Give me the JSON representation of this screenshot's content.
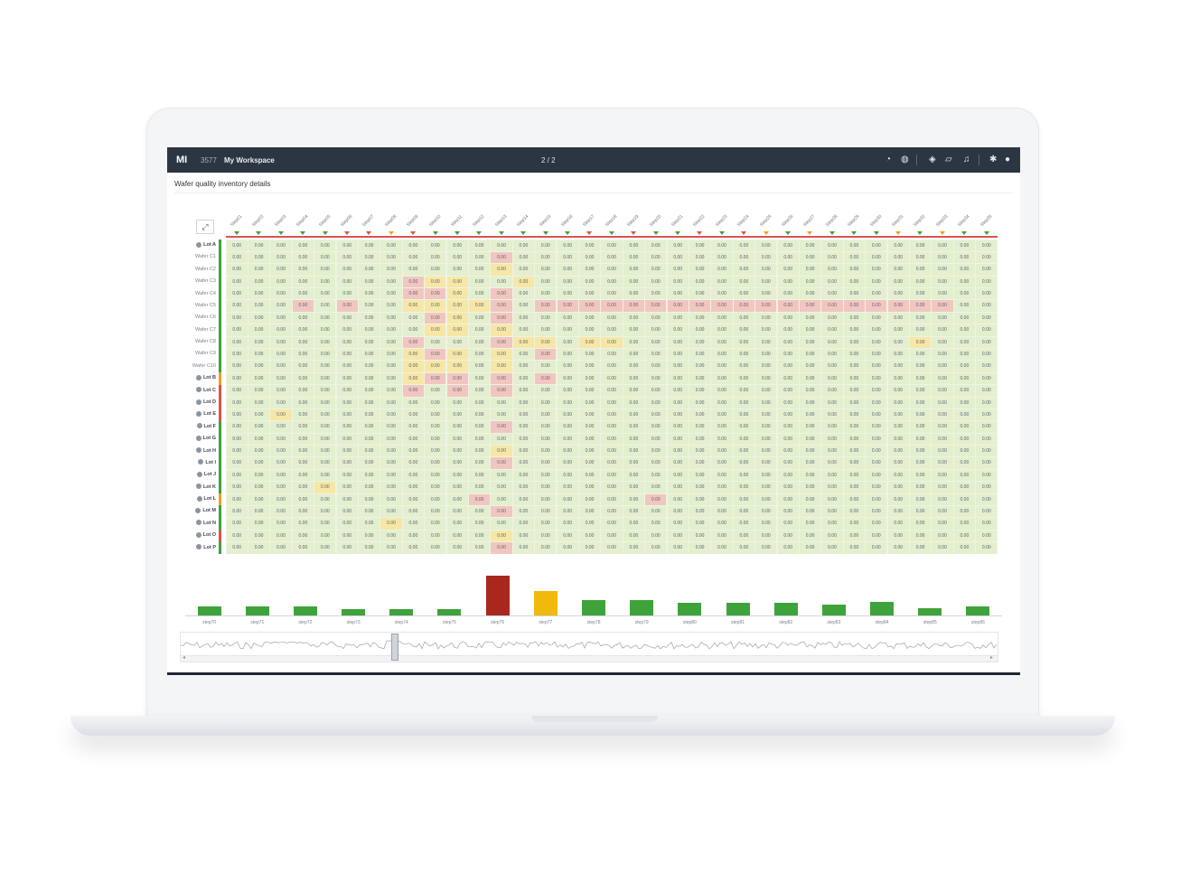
{
  "app": {
    "logo": "MI",
    "workspace_id": "3577",
    "workspace_name": "My Workspace",
    "pager": "2 / 2",
    "icons": [
      "dashboard-icon",
      "globe-icon",
      "cube-icon",
      "map-icon",
      "bell-icon",
      "gear-icon",
      "user-icon"
    ]
  },
  "page": {
    "subtitle": "Wafer quality inventory details",
    "expand_icon": "⤢"
  },
  "matrix": {
    "columns": [
      "Step01",
      "Step02",
      "Step03",
      "Step04",
      "Step05",
      "Step06",
      "Step07",
      "Step08",
      "Step09",
      "Step10",
      "Step11",
      "Step12",
      "Step13",
      "Step14",
      "Step15",
      "Step16",
      "Step17",
      "Step18",
      "Step19",
      "Step20",
      "Step21",
      "Step22",
      "Step23",
      "Step24",
      "Step25",
      "Step26",
      "Step27",
      "Step28",
      "Step29",
      "Step30",
      "Step31",
      "Step32",
      "Step33",
      "Step34",
      "Step35"
    ],
    "column_markers": [
      "green",
      "green",
      "green",
      "green",
      "green",
      "red",
      "red",
      "orange",
      "red",
      "green",
      "green",
      "green",
      "green",
      "green",
      "green",
      "green",
      "red",
      "green",
      "red",
      "green",
      "green",
      "red",
      "green",
      "red",
      "orange",
      "green",
      "orange",
      "green",
      "green",
      "green",
      "orange",
      "green",
      "orange",
      "green",
      "green"
    ],
    "rows": [
      {
        "label": "Lot A",
        "lot": true,
        "status": "green"
      },
      {
        "label": "Wafer C1",
        "lot": false,
        "status": "green"
      },
      {
        "label": "Wafer C2",
        "lot": false,
        "status": "green"
      },
      {
        "label": "Wafer C3",
        "lot": false,
        "status": "green"
      },
      {
        "label": "Wafer C4",
        "lot": false,
        "status": "green"
      },
      {
        "label": "Wafer C5",
        "lot": false,
        "status": "green"
      },
      {
        "label": "Wafer C6",
        "lot": false,
        "status": "green"
      },
      {
        "label": "Wafer C7",
        "lot": false,
        "status": "green"
      },
      {
        "label": "Wafer C8",
        "lot": false,
        "status": "green"
      },
      {
        "label": "Wafer C9",
        "lot": false,
        "status": "green"
      },
      {
        "label": "Wafer C10",
        "lot": false,
        "status": "green"
      },
      {
        "label": "Lot B",
        "lot": true,
        "status": "orange"
      },
      {
        "label": "Lot C",
        "lot": true,
        "status": "red"
      },
      {
        "label": "Lot D",
        "lot": true,
        "status": "red"
      },
      {
        "label": "Lot E",
        "lot": true,
        "status": "red"
      },
      {
        "label": "Lot F",
        "lot": true,
        "status": "green"
      },
      {
        "label": "Lot G",
        "lot": true,
        "status": "green"
      },
      {
        "label": "Lot H",
        "lot": true,
        "status": "green"
      },
      {
        "label": "Lot I",
        "lot": true,
        "status": "green"
      },
      {
        "label": "Lot J",
        "lot": true,
        "status": "green"
      },
      {
        "label": "Lot K",
        "lot": true,
        "status": "green"
      },
      {
        "label": "Lot L",
        "lot": true,
        "status": "orange"
      },
      {
        "label": "Lot M",
        "lot": true,
        "status": "green"
      },
      {
        "label": "Lot N",
        "lot": true,
        "status": "green"
      },
      {
        "label": "Lot O",
        "lot": true,
        "status": "red"
      },
      {
        "label": "Lot P",
        "lot": true,
        "status": "green"
      }
    ],
    "cell_values": [
      "0.00",
      "0.00",
      "0.00",
      "0.00"
    ],
    "highlights": [
      {
        "row": 1,
        "col": 12,
        "color": "red"
      },
      {
        "row": 2,
        "col": 12,
        "color": "yellow"
      },
      {
        "row": 3,
        "col": 8,
        "color": "red"
      },
      {
        "row": 3,
        "col": 9,
        "color": "yellow"
      },
      {
        "row": 3,
        "col": 10,
        "color": "yellow"
      },
      {
        "row": 3,
        "col": 13,
        "color": "yellow"
      },
      {
        "row": 4,
        "col": 8,
        "color": "red"
      },
      {
        "row": 4,
        "col": 9,
        "color": "red"
      },
      {
        "row": 4,
        "col": 10,
        "color": "yellow"
      },
      {
        "row": 4,
        "col": 12,
        "color": "red"
      },
      {
        "row": 5,
        "col": 3,
        "color": "red"
      },
      {
        "row": 5,
        "col": 5,
        "color": "red"
      },
      {
        "row": 5,
        "col": 8,
        "color": "yellow"
      },
      {
        "row": 5,
        "col": 9,
        "color": "yellow"
      },
      {
        "row": 5,
        "col": 10,
        "color": "yellow"
      },
      {
        "row": 5,
        "col": 11,
        "color": "yellow"
      },
      {
        "row": 5,
        "col": 12,
        "color": "red"
      },
      {
        "row": 5,
        "col": 14,
        "color": "red"
      },
      {
        "row": 5,
        "col": 15,
        "color": "red"
      },
      {
        "row": 5,
        "col": 16,
        "color": "red"
      },
      {
        "row": 5,
        "col": 17,
        "color": "red"
      },
      {
        "row": 5,
        "col": 18,
        "color": "red"
      },
      {
        "row": 5,
        "col": 19,
        "color": "red"
      },
      {
        "row": 5,
        "col": 20,
        "color": "red"
      },
      {
        "row": 5,
        "col": 21,
        "color": "red"
      },
      {
        "row": 5,
        "col": 22,
        "color": "red"
      },
      {
        "row": 5,
        "col": 23,
        "color": "red"
      },
      {
        "row": 5,
        "col": 24,
        "color": "red"
      },
      {
        "row": 5,
        "col": 25,
        "color": "red"
      },
      {
        "row": 5,
        "col": 26,
        "color": "red"
      },
      {
        "row": 5,
        "col": 27,
        "color": "red"
      },
      {
        "row": 5,
        "col": 28,
        "color": "red"
      },
      {
        "row": 5,
        "col": 29,
        "color": "red"
      },
      {
        "row": 5,
        "col": 30,
        "color": "red"
      },
      {
        "row": 5,
        "col": 31,
        "color": "red"
      },
      {
        "row": 5,
        "col": 32,
        "color": "red"
      },
      {
        "row": 6,
        "col": 9,
        "color": "red"
      },
      {
        "row": 6,
        "col": 10,
        "color": "yellow"
      },
      {
        "row": 6,
        "col": 12,
        "color": "red"
      },
      {
        "row": 7,
        "col": 9,
        "color": "yellow"
      },
      {
        "row": 7,
        "col": 10,
        "color": "yellow"
      },
      {
        "row": 7,
        "col": 12,
        "color": "yellow"
      },
      {
        "row": 8,
        "col": 8,
        "color": "red"
      },
      {
        "row": 8,
        "col": 12,
        "color": "red"
      },
      {
        "row": 8,
        "col": 13,
        "color": "yellow"
      },
      {
        "row": 8,
        "col": 14,
        "color": "yellow"
      },
      {
        "row": 8,
        "col": 16,
        "color": "yellow"
      },
      {
        "row": 8,
        "col": 17,
        "color": "yellow"
      },
      {
        "row": 8,
        "col": 31,
        "color": "yellow"
      },
      {
        "row": 9,
        "col": 8,
        "color": "yellow"
      },
      {
        "row": 9,
        "col": 9,
        "color": "red"
      },
      {
        "row": 9,
        "col": 10,
        "color": "yellow"
      },
      {
        "row": 9,
        "col": 12,
        "color": "yellow"
      },
      {
        "row": 9,
        "col": 14,
        "color": "red"
      },
      {
        "row": 10,
        "col": 8,
        "color": "yellow"
      },
      {
        "row": 10,
        "col": 9,
        "color": "yellow"
      },
      {
        "row": 10,
        "col": 10,
        "color": "yellow"
      },
      {
        "row": 10,
        "col": 12,
        "color": "yellow"
      },
      {
        "row": 11,
        "col": 8,
        "color": "yellow"
      },
      {
        "row": 11,
        "col": 9,
        "color": "red"
      },
      {
        "row": 11,
        "col": 10,
        "color": "red"
      },
      {
        "row": 11,
        "col": 12,
        "color": "red"
      },
      {
        "row": 11,
        "col": 14,
        "color": "red"
      },
      {
        "row": 12,
        "col": 8,
        "color": "red"
      },
      {
        "row": 12,
        "col": 10,
        "color": "red"
      },
      {
        "row": 12,
        "col": 12,
        "color": "red"
      },
      {
        "row": 14,
        "col": 2,
        "color": "yellow"
      },
      {
        "row": 15,
        "col": 12,
        "color": "red"
      },
      {
        "row": 17,
        "col": 12,
        "color": "yellow"
      },
      {
        "row": 18,
        "col": 12,
        "color": "red"
      },
      {
        "row": 20,
        "col": 4,
        "color": "yellow"
      },
      {
        "row": 21,
        "col": 11,
        "color": "red"
      },
      {
        "row": 21,
        "col": 19,
        "color": "red"
      },
      {
        "row": 22,
        "col": 12,
        "color": "red"
      },
      {
        "row": 23,
        "col": 7,
        "color": "yellow"
      },
      {
        "row": 24,
        "col": 12,
        "color": "yellow"
      },
      {
        "row": 25,
        "col": 12,
        "color": "red"
      }
    ]
  },
  "chart_data": {
    "type": "bar",
    "categories": [
      "step70",
      "step71",
      "step72",
      "step73",
      "step74",
      "step75",
      "step76",
      "step77",
      "step78",
      "step79",
      "step80",
      "step81",
      "step82",
      "step83",
      "step84",
      "step85",
      "step86"
    ],
    "values": [
      10,
      10,
      10,
      7,
      7,
      7,
      42,
      26,
      16,
      16,
      13,
      13,
      13,
      11,
      14,
      8,
      10
    ],
    "colors": [
      "green",
      "green",
      "green",
      "green",
      "green",
      "green",
      "red",
      "yellow",
      "green",
      "green",
      "green",
      "green",
      "green",
      "green",
      "green",
      "green",
      "green"
    ]
  },
  "colors": {
    "topbar": "#2c3643",
    "grid_bg": "#eef4e2",
    "cell_green": "#e3efce",
    "cell_red": "#f2c6c0",
    "cell_yellow": "#f7e7a6",
    "bar_green": "#3ea33a",
    "bar_red": "#a8281e",
    "bar_yellow": "#f0b90b",
    "status_green": "#3ea33a",
    "status_orange": "#f0a020",
    "status_red": "#d9534f"
  }
}
